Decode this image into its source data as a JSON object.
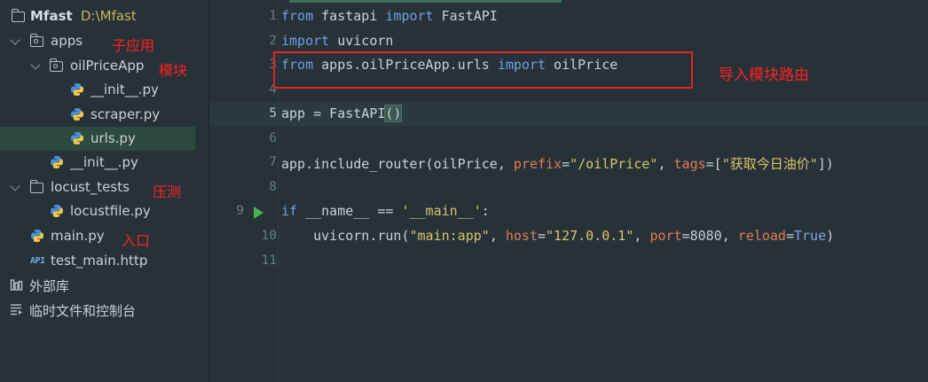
{
  "project": {
    "name": "Mfast",
    "path": "D:\\Mfast",
    "items": [
      {
        "label": "apps",
        "annotation": "子应用"
      },
      {
        "label": "oilPriceApp",
        "annotation": "模块"
      },
      {
        "label": "__init__.py"
      },
      {
        "label": "scraper.py"
      },
      {
        "label": "urls.py"
      },
      {
        "label": "__init__.py"
      },
      {
        "label": "locust_tests",
        "annotation": "压测"
      },
      {
        "label": "locustfile.py"
      },
      {
        "label": "main.py",
        "annotation": "入口"
      },
      {
        "label": "test_main.http",
        "icon_text": "API"
      },
      {
        "label": "外部库"
      },
      {
        "label": "临时文件和控制台"
      }
    ]
  },
  "editor": {
    "annotation": "导入模块路由",
    "line_numbers": [
      "1",
      "2",
      "3",
      "4",
      "5",
      "6",
      "7",
      "8",
      "9",
      "10",
      "11"
    ],
    "current_line": "5",
    "lines": {
      "l1": {
        "a": "from",
        "b": " fastapi ",
        "c": "import",
        "d": " FastAPI"
      },
      "l2": {
        "a": "import",
        "b": " uvicorn"
      },
      "l3": {
        "a": "from",
        "b": " apps.oilPriceApp.urls ",
        "c": "import",
        "d": " oilPrice"
      },
      "l5": {
        "a": "app = FastAPI",
        "b": "()"
      },
      "l7": {
        "a": "app.include_router(oilPrice, ",
        "b": "prefix",
        "c": "=",
        "d": "\"/oilPrice\"",
        "e": ", ",
        "f": "tags",
        "g": "=[",
        "h": "\"获取今日油价\"",
        "i": "])"
      },
      "l9": {
        "a": "if",
        "b": " __name__ == ",
        "c": "'__main__'",
        "d": ":"
      },
      "l10": {
        "a": "    uvicorn.run(",
        "b": "\"main:app\"",
        "c": ", ",
        "d": "host",
        "e": "=",
        "f": "\"127.0.0.1\"",
        "g": ", ",
        "h": "port",
        "i": "=8080, ",
        "j": "reload",
        "k": "=",
        "l": "True",
        "m": ")"
      }
    }
  },
  "colors": {
    "background": "#263238",
    "keyword": "#6f9fe0",
    "string": "#d9c36a",
    "parameter": "#e47a55",
    "annotation": "#ff2020",
    "selection": "#2d4a3e"
  }
}
